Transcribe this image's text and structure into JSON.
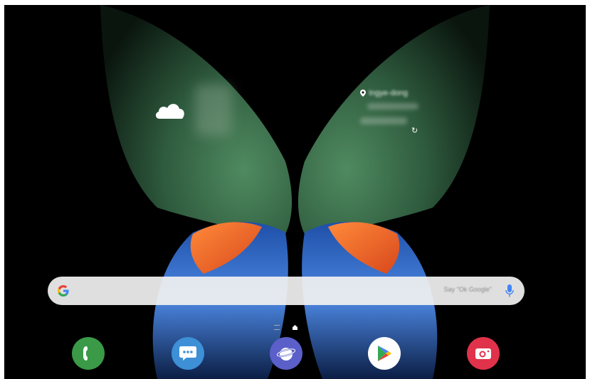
{
  "weather": {
    "icon": "cloud-icon"
  },
  "clock": {
    "location": "Ingye-dong",
    "refresh_icon": "refresh-icon"
  },
  "search_bar": {
    "logo": "google-g-icon",
    "placeholder": "Say \"Ok Google\"",
    "mic_icon": "mic-icon"
  },
  "page_indicator": {
    "items": [
      "menu-lines-icon",
      "home-page-icon"
    ],
    "active": "home-page-icon"
  },
  "dock": {
    "apps": [
      {
        "name": "Phone",
        "icon": "phone-icon",
        "color": "#3a9a47"
      },
      {
        "name": "Messages",
        "icon": "messages-icon",
        "color": "#3d8fd6"
      },
      {
        "name": "Internet",
        "icon": "internet-icon",
        "color": "#5a5fc9"
      },
      {
        "name": "Play Store",
        "icon": "play-store-icon",
        "color": "#ffffff"
      },
      {
        "name": "Camera",
        "icon": "camera-icon",
        "color": "#e0324a"
      }
    ]
  },
  "colors": {
    "wallpaper_bg": "#000000",
    "wing_green": "#2f5a3f",
    "wing_orange": "#f06a2a",
    "wing_blue": "#2f6fd0"
  }
}
